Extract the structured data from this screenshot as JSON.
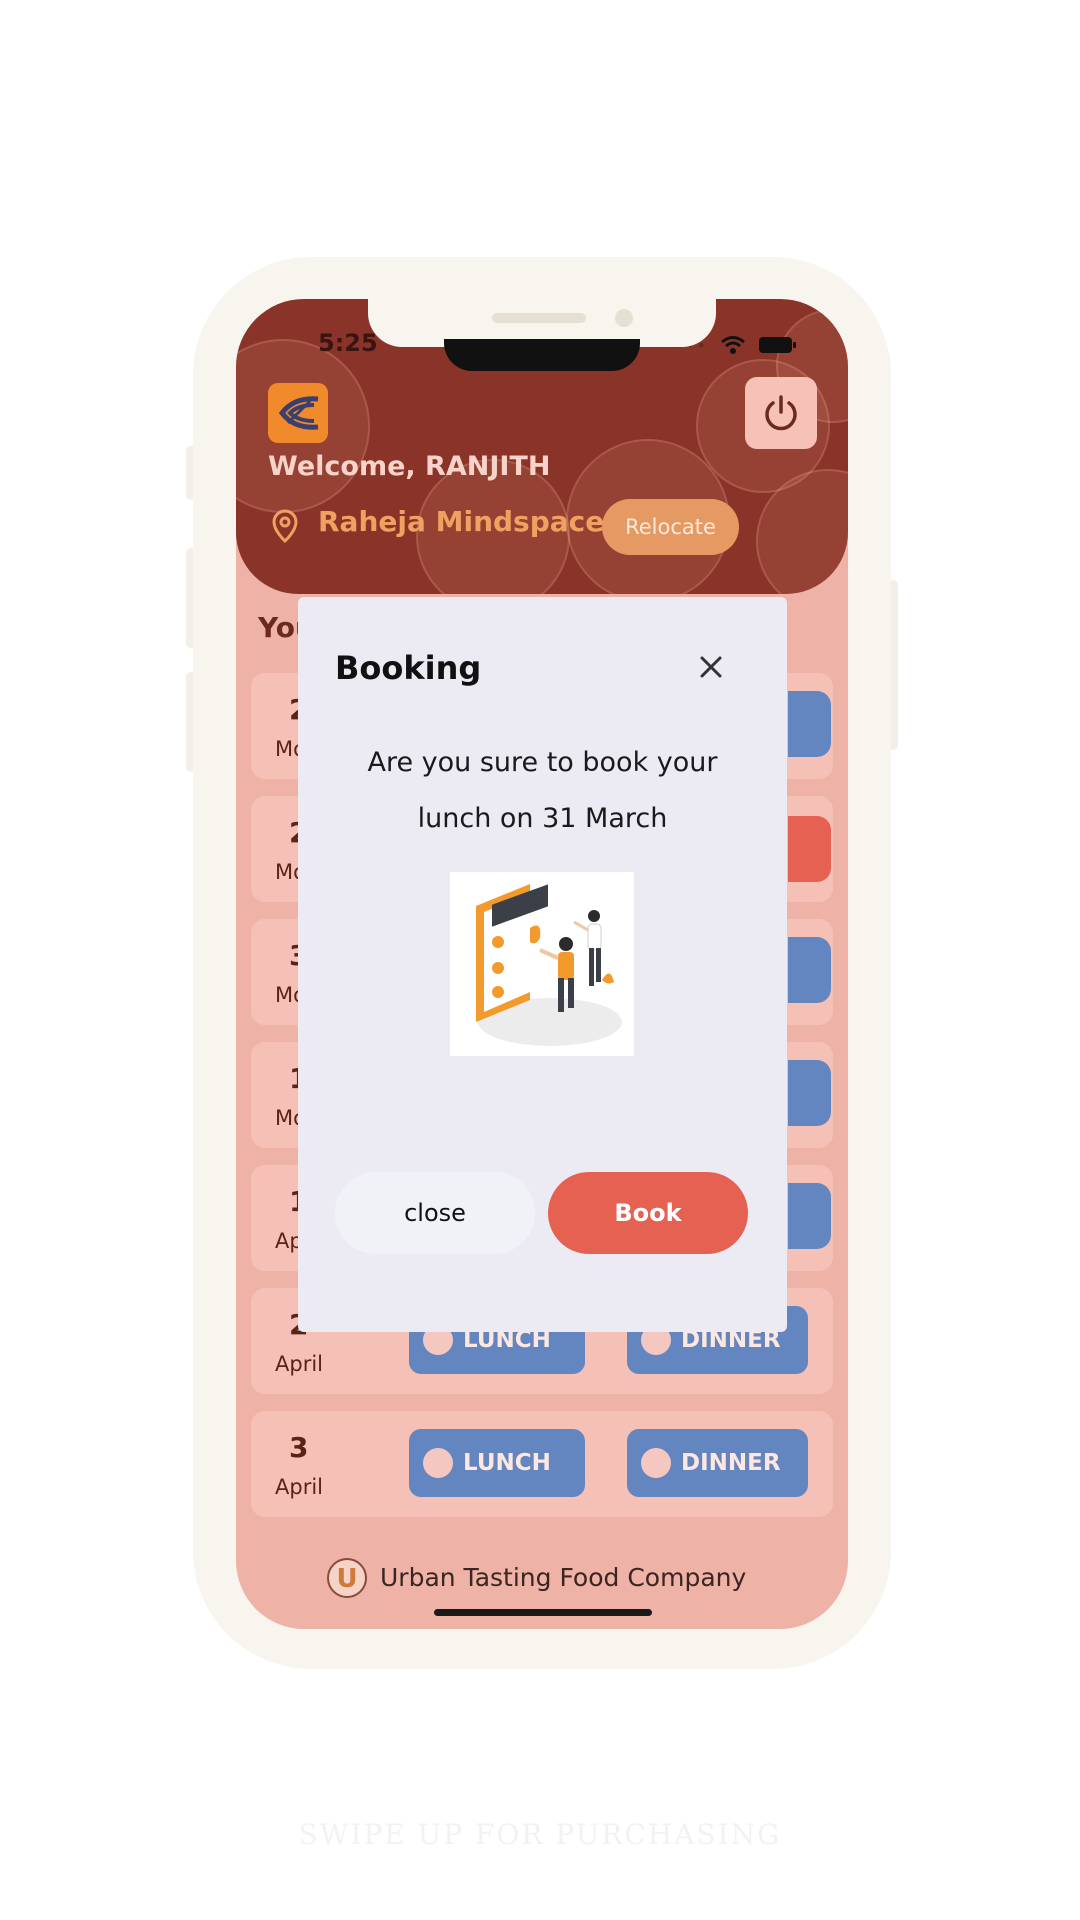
{
  "status_bar": {
    "time": "5:25"
  },
  "header": {
    "welcome": "Welcome, RANJITH",
    "location": "Raheja Mindspace",
    "relocate_label": "Relocate"
  },
  "section_title": "You",
  "rows": [
    {
      "day": "2",
      "month": "Mo"
    },
    {
      "day": "2",
      "month": "Mo"
    },
    {
      "day": "3",
      "month": "Mo"
    },
    {
      "day": "1",
      "month": "Mo"
    },
    {
      "day": "1",
      "month": "Ap"
    },
    {
      "day": "2",
      "month": "April",
      "lunch": "LUNCH",
      "dinner": "DINNER"
    },
    {
      "day": "3",
      "month": "April",
      "lunch": "LUNCH",
      "dinner": "DINNER"
    }
  ],
  "footer": {
    "company": "Urban Tasting Food Company",
    "logo_letter": "U"
  },
  "modal": {
    "title": "Booking",
    "message": "Are you sure to book your lunch on 31 March",
    "close_label": "close",
    "book_label": "Book"
  },
  "swipe_hint": "SWIPE UP FOR PURCHASING",
  "colors": {
    "header_bg": "#8a3429",
    "screen_bg": "#efb2a6",
    "meal_button": "#6386c0",
    "booked_button": "#e56152",
    "modal_bg": "#ecebf4"
  },
  "icons": [
    "app-logo-icon",
    "power-icon",
    "location-pin-icon",
    "close-icon",
    "wifi-icon",
    "battery-icon",
    "signal-icon",
    "booking-illustration",
    "company-logo-icon"
  ]
}
